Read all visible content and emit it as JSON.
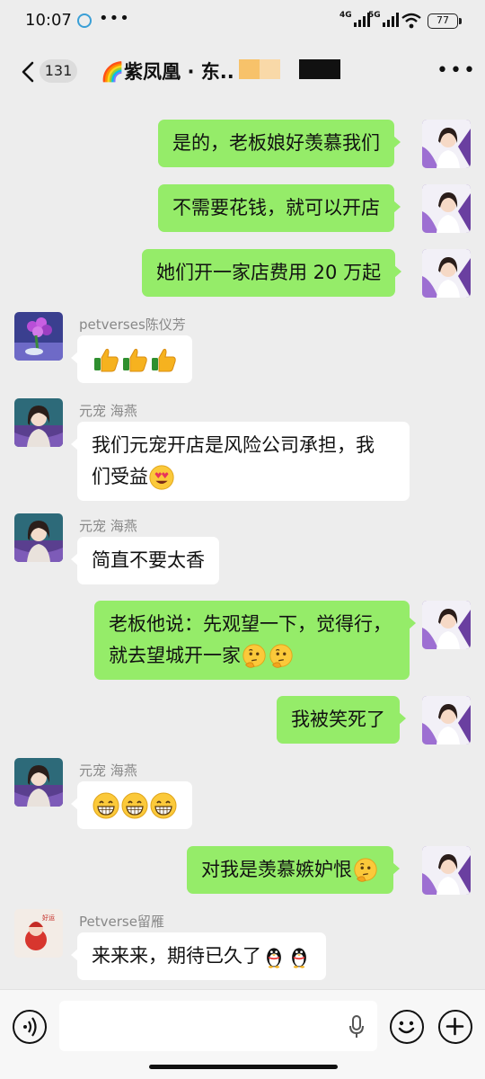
{
  "status_bar": {
    "time": "10:07",
    "dots": "•••",
    "signal_1_label": "4G",
    "signal_2_label": "5G",
    "battery": "77"
  },
  "header": {
    "unread_count": "131",
    "title": "🌈紫凤凰 · 东..",
    "more_label": "•••"
  },
  "messages": [
    {
      "side": "me",
      "text": "是的，老板娘好羡慕我们"
    },
    {
      "side": "me",
      "text": "不需要花钱，就可以开店"
    },
    {
      "side": "me",
      "text": "她们开一家店费用 20 万起"
    },
    {
      "side": "other",
      "sender": "petverses陈仪芳",
      "icons": [
        "thumbs-up-icon",
        "thumbs-up-icon",
        "thumbs-up-icon"
      ]
    },
    {
      "side": "other",
      "sender": "元宠 海燕",
      "text": "我们元宠开店是风险公司承担，我",
      "text2": "们受益",
      "icons": [
        "heart-eyes-icon"
      ]
    },
    {
      "side": "other",
      "sender": "元宠 海燕",
      "text": "简直不要太香"
    },
    {
      "side": "me",
      "text": "老板他说：先观望一下，觉得行，",
      "text2": "就去望城开一家",
      "icons": [
        "thinking-face-icon",
        "thinking-face-icon"
      ]
    },
    {
      "side": "me",
      "text": "我被笑死了"
    },
    {
      "side": "other",
      "sender": "元宠 海燕",
      "icons": [
        "grin-icon",
        "grin-icon",
        "grin-icon"
      ]
    },
    {
      "side": "me",
      "text": "对我是羡慕嫉妒恨",
      "icons": [
        "thinking-face-icon"
      ]
    },
    {
      "side": "other",
      "sender": "Petverse留雁",
      "text": "来来来，期待已久了",
      "icons": [
        "penguin-icon",
        "penguin-icon"
      ]
    }
  ],
  "colors": {
    "my_bubble": "#95ec69",
    "other_bubble": "#ffffff",
    "background": "#ededed"
  }
}
